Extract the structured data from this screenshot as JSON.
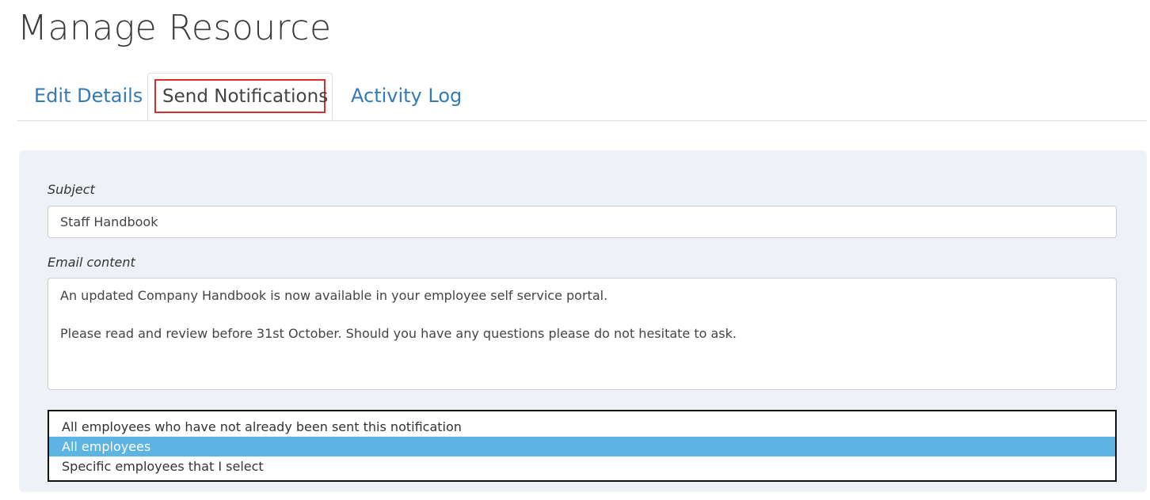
{
  "page_title": "Manage Resource",
  "tabs": [
    {
      "label": "Edit Details",
      "active": false
    },
    {
      "label": "Send Notifications",
      "active": true
    },
    {
      "label": "Activity Log",
      "active": false
    }
  ],
  "form": {
    "subject_label": "Subject",
    "subject_value": "Staff Handbook",
    "email_label": "Email content",
    "email_lines": [
      "An updated Company Handbook is now available in your employee self service portal.",
      "",
      "Please read and review before 31st October. Should you have any questions please do not hesitate to ask."
    ],
    "recipient_options": [
      {
        "label": "All employees who have not already been sent this notification",
        "selected": false
      },
      {
        "label": "All employees",
        "selected": true
      },
      {
        "label": "Specific employees that I select",
        "selected": false
      }
    ]
  },
  "colors": {
    "tab_link": "#337ab7",
    "highlight_box": "#d62e2e",
    "panel_bg": "#eef2f6",
    "selected_option_bg": "#5bb4e1"
  }
}
